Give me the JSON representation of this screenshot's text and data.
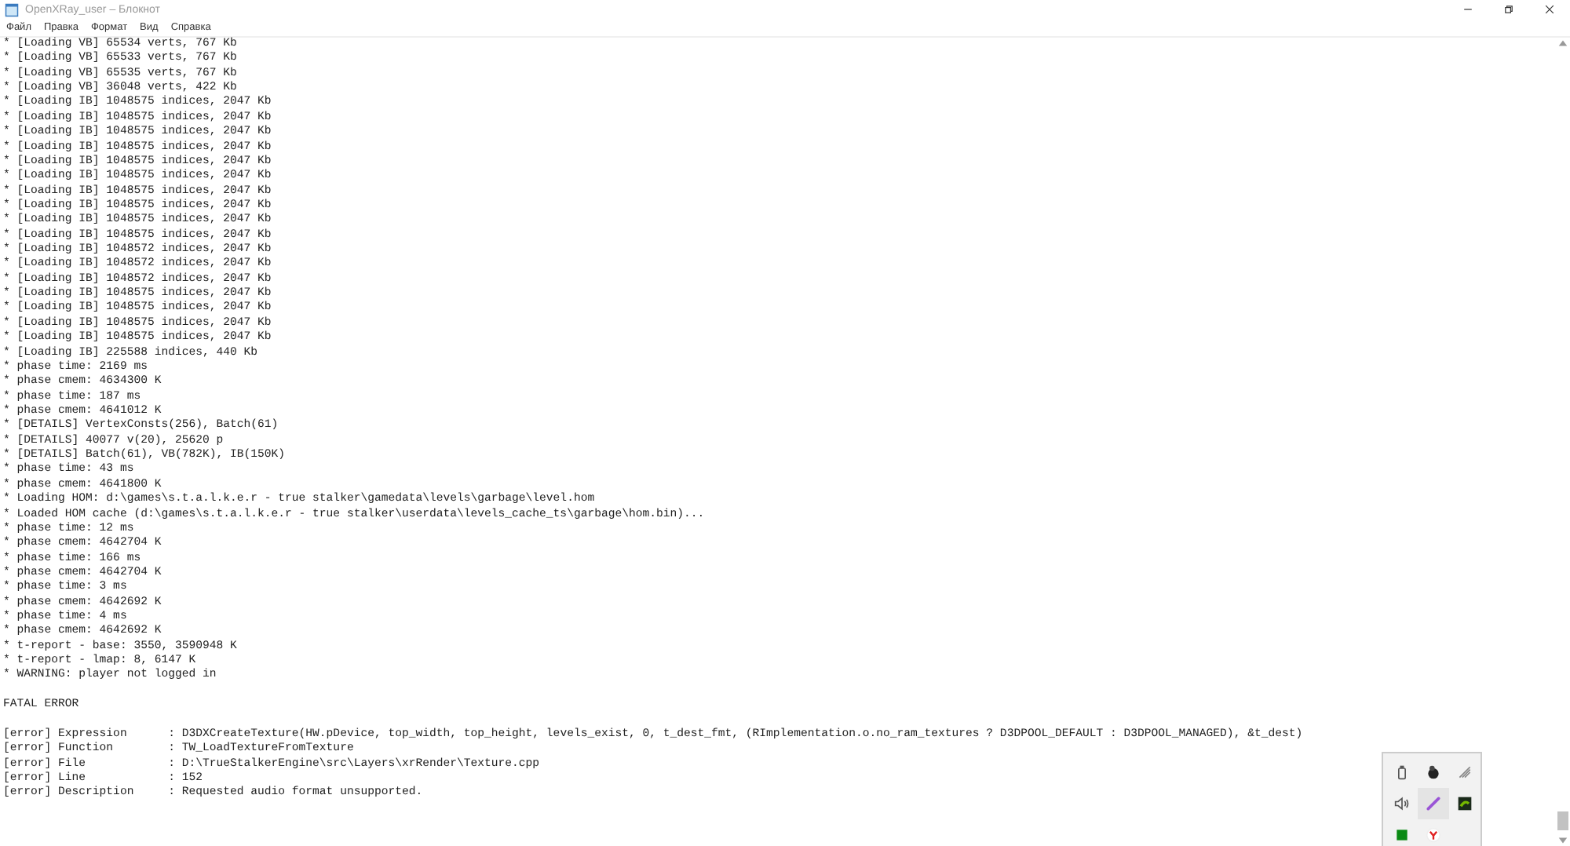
{
  "window": {
    "title": "OpenXRay_user – Блокнот"
  },
  "menu": [
    "Файл",
    "Правка",
    "Формат",
    "Вид",
    "Справка"
  ],
  "text_blocks": [
    [
      "* [Loading VB] 65534 verts, 767 Kb",
      "* [Loading VB] 65533 verts, 767 Kb",
      "* [Loading VB] 65535 verts, 767 Kb",
      "* [Loading VB] 36048 verts, 422 Kb",
      "* [Loading IB] 1048575 indices, 2047 Kb",
      "* [Loading IB] 1048575 indices, 2047 Kb",
      "* [Loading IB] 1048575 indices, 2047 Kb",
      "* [Loading IB] 1048575 indices, 2047 Kb",
      "* [Loading IB] 1048575 indices, 2047 Kb",
      "* [Loading IB] 1048575 indices, 2047 Kb",
      "* [Loading IB] 1048575 indices, 2047 Kb",
      "* [Loading IB] 1048575 indices, 2047 Kb",
      "* [Loading IB] 1048575 indices, 2047 Kb",
      "* [Loading IB] 1048575 indices, 2047 Kb",
      "* [Loading IB] 1048572 indices, 2047 Kb",
      "* [Loading IB] 1048572 indices, 2047 Kb",
      "* [Loading IB] 1048572 indices, 2047 Kb",
      "* [Loading IB] 1048575 indices, 2047 Kb",
      "* [Loading IB] 1048575 indices, 2047 Kb",
      "* [Loading IB] 1048575 indices, 2047 Kb",
      "* [Loading IB] 1048575 indices, 2047 Kb",
      "* [Loading IB] 225588 indices, 440 Kb",
      "* phase time: 2169 ms",
      "* phase cmem: 4634300 K",
      "* phase time: 187 ms",
      "* phase cmem: 4641012 K",
      "* [DETAILS] VertexConsts(256), Batch(61)",
      "* [DETAILS] 40077 v(20), 25620 p",
      "* [DETAILS] Batch(61), VB(782K), IB(150K)",
      "* phase time: 43 ms",
      "* phase cmem: 4641800 K",
      "* Loading HOM: d:\\games\\s.t.a.l.k.e.r - true stalker\\gamedata\\levels\\garbage\\level.hom",
      "* Loaded HOM cache (d:\\games\\s.t.a.l.k.e.r - true stalker\\userdata\\levels_cache_ts\\garbage\\hom.bin)...",
      "* phase time: 12 ms",
      "* phase cmem: 4642704 K",
      "* phase time: 166 ms",
      "* phase cmem: 4642704 K",
      "* phase time: 3 ms",
      "* phase cmem: 4642692 K",
      "* phase time: 4 ms",
      "* phase cmem: 4642692 K",
      "* t-report - base: 3550, 3590948 K",
      "* t-report - lmap: 8, 6147 K",
      "* WARNING: player not logged in"
    ],
    [
      "FATAL ERROR"
    ],
    [
      "[error] Expression\t: D3DXCreateTexture(HW.pDevice, top_width, top_height, levels_exist, 0, t_dest_fmt, (RImplementation.o.no_ram_textures ? D3DPOOL_DEFAULT : D3DPOOL_MANAGED), &t_dest)",
      "[error] Function\t: TW_LoadTextureFromTexture",
      "[error] File\t\t: D:\\TrueStalkerEngine\\src\\Layers\\xrRender\\Texture.cpp",
      "[error] Line\t\t: 152",
      "[error] Description\t: Requested audio format unsupported."
    ]
  ],
  "tray_icons": [
    {
      "kind": "usb",
      "selected": false
    },
    {
      "kind": "app",
      "selected": false
    },
    {
      "kind": "network",
      "selected": false
    },
    {
      "kind": "speaker",
      "selected": false
    },
    {
      "kind": "pen",
      "selected": true
    },
    {
      "kind": "gpu",
      "selected": false
    },
    {
      "kind": "square",
      "selected": false
    },
    {
      "kind": "fork",
      "selected": false
    }
  ]
}
